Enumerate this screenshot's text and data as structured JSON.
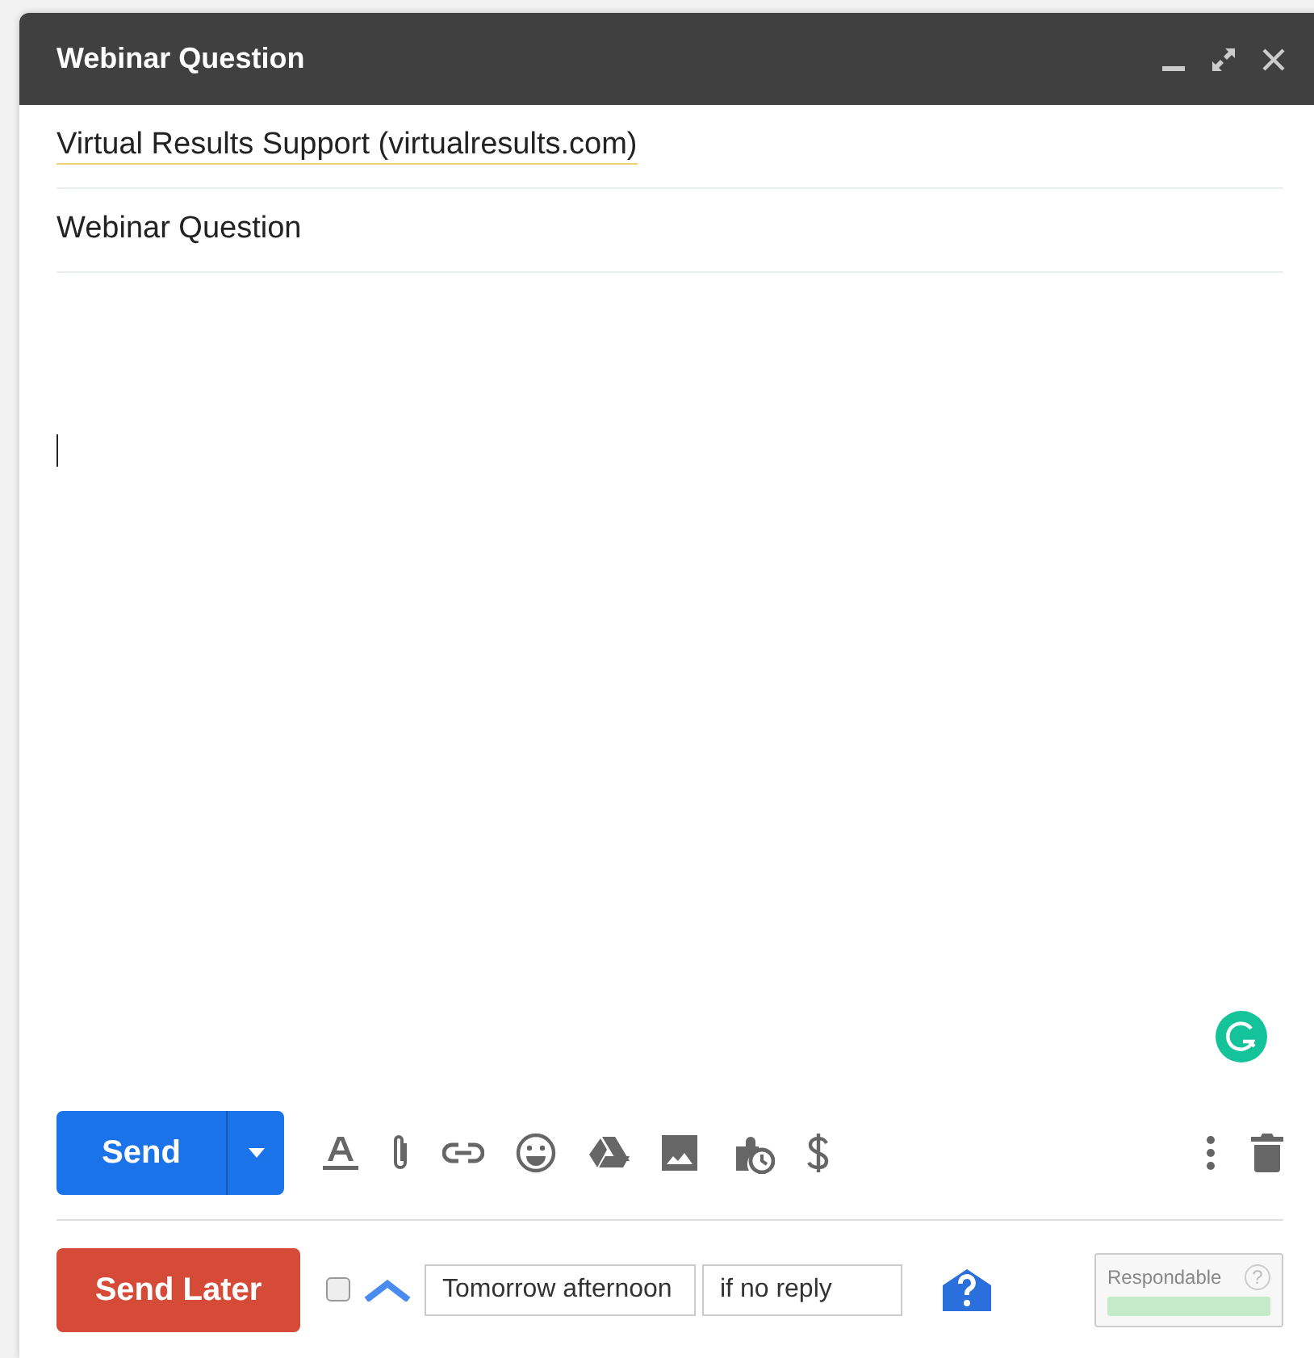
{
  "window": {
    "title": "Webinar Question"
  },
  "recipient": "Virtual Results Support (virtualresults.com)",
  "subject": "Webinar Question",
  "send_button": {
    "label": "Send"
  },
  "send_later": {
    "label": "Send Later",
    "checked": false,
    "time": "Tomorrow afternoon",
    "condition": "if no reply"
  },
  "respondable": {
    "label": "Respondable",
    "help": "?",
    "level": 1
  }
}
